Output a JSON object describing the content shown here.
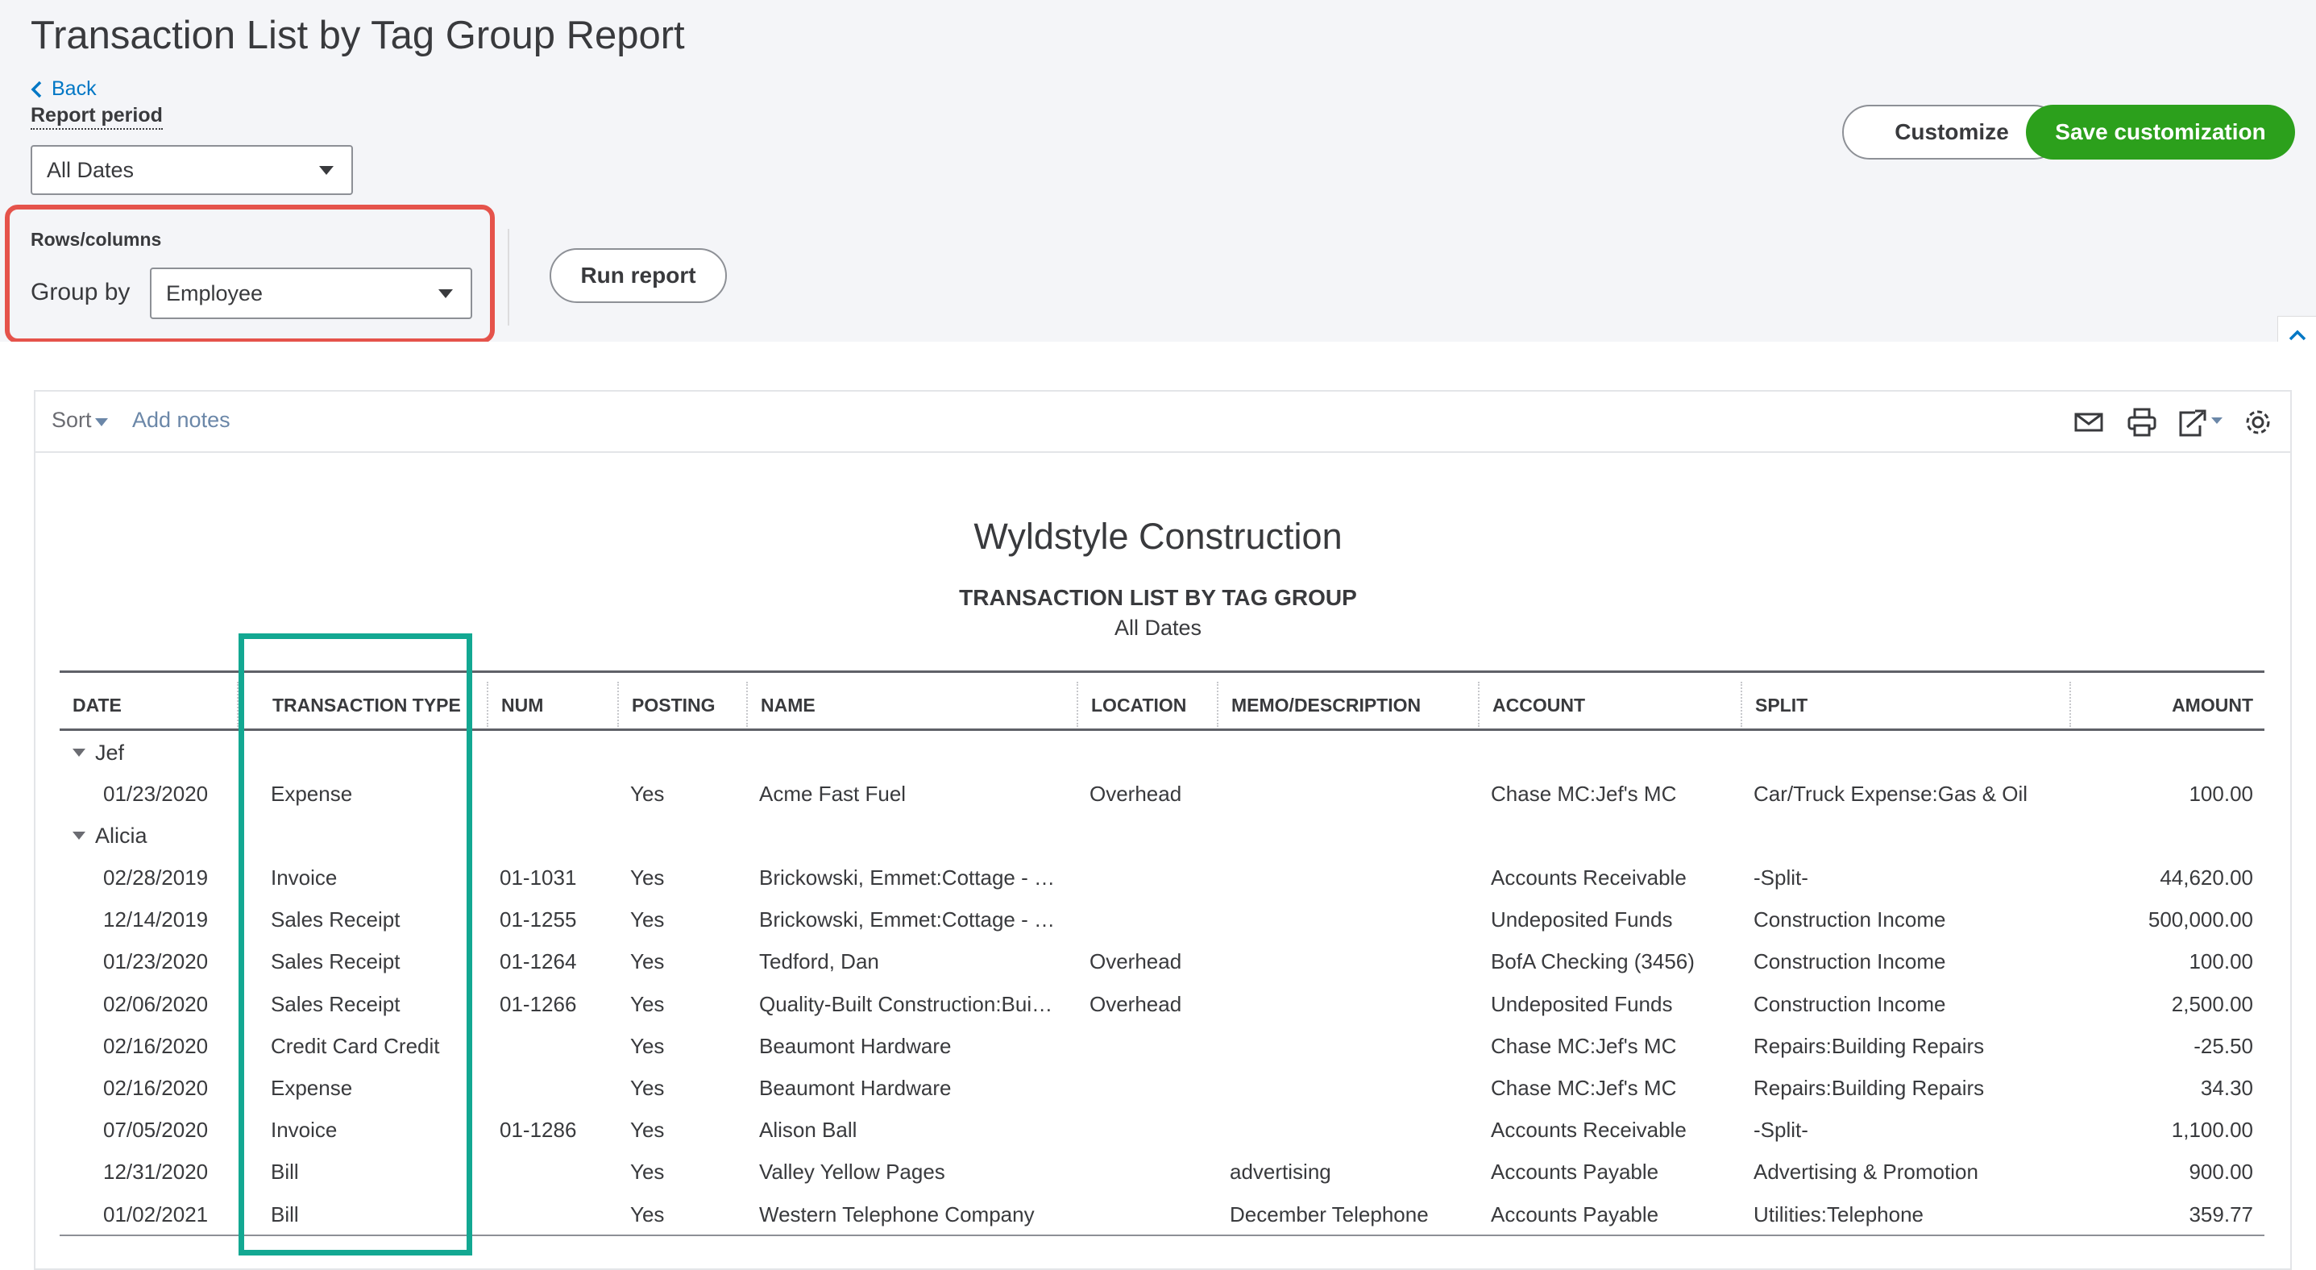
{
  "page": {
    "title": "Transaction List by Tag Group Report",
    "back_label": "Back",
    "report_period_label": "Report period",
    "report_period_value": "All Dates",
    "rows_columns_label": "Rows/columns",
    "group_by_label": "Group by",
    "group_by_value": "Employee",
    "run_report_label": "Run report",
    "customize_label": "Customize",
    "save_customization_label": "Save customization"
  },
  "toolbar": {
    "sort_label": "Sort",
    "add_notes_label": "Add notes",
    "icons": [
      "email-icon",
      "print-icon",
      "export-icon",
      "settings-icon"
    ]
  },
  "report": {
    "company": "Wyldstyle Construction",
    "name": "TRANSACTION LIST BY TAG GROUP",
    "dates": "All Dates",
    "columns": [
      "DATE",
      "TRANSACTION TYPE",
      "NUM",
      "POSTING",
      "NAME",
      "LOCATION",
      "MEMO/DESCRIPTION",
      "ACCOUNT",
      "SPLIT",
      "AMOUNT"
    ],
    "groups": [
      {
        "name": "Jef",
        "rows": [
          [
            "01/23/2020",
            "Expense",
            "",
            "Yes",
            "Acme Fast Fuel",
            "Overhead",
            "",
            "Chase MC:Jef's MC",
            "Car/Truck Expense:Gas & Oil",
            "100.00"
          ]
        ]
      },
      {
        "name": "Alicia",
        "rows": [
          [
            "02/28/2019",
            "Invoice",
            "01-1031",
            "Yes",
            "Brickowski, Emmet:Cottage - …",
            "",
            "",
            "Accounts Receivable",
            "-Split-",
            "44,620.00"
          ],
          [
            "12/14/2019",
            "Sales Receipt",
            "01-1255",
            "Yes",
            "Brickowski, Emmet:Cottage - …",
            "",
            "",
            "Undeposited Funds",
            "Construction Income",
            "500,000.00"
          ],
          [
            "01/23/2020",
            "Sales Receipt",
            "01-1264",
            "Yes",
            "Tedford, Dan",
            "Overhead",
            "",
            "BofA Checking (3456)",
            "Construction Income",
            "100.00"
          ],
          [
            "02/06/2020",
            "Sales Receipt",
            "01-1266",
            "Yes",
            "Quality-Built Construction:Bui…",
            "Overhead",
            "",
            "Undeposited Funds",
            "Construction Income",
            "2,500.00"
          ],
          [
            "02/16/2020",
            "Credit Card Credit",
            "",
            "Yes",
            "Beaumont Hardware",
            "",
            "",
            "Chase MC:Jef's MC",
            "Repairs:Building Repairs",
            "-25.50"
          ],
          [
            "02/16/2020",
            "Expense",
            "",
            "Yes",
            "Beaumont Hardware",
            "",
            "",
            "Chase MC:Jef's MC",
            "Repairs:Building Repairs",
            "34.30"
          ],
          [
            "07/05/2020",
            "Invoice",
            "01-1286",
            "Yes",
            "Alison Ball",
            "",
            "",
            "Accounts Receivable",
            "-Split-",
            "1,100.00"
          ],
          [
            "12/31/2020",
            "Bill",
            "",
            "Yes",
            "Valley Yellow Pages",
            "",
            "advertising",
            "Accounts Payable",
            "Advertising & Promotion",
            "900.00"
          ],
          [
            "01/02/2021",
            "Bill",
            "",
            "Yes",
            "Western Telephone Company",
            "",
            "December Telephone",
            "Accounts Payable",
            "Utilities:Telephone",
            "359.77"
          ]
        ]
      }
    ]
  },
  "colors": {
    "primary_green": "#2ca01c",
    "link_blue": "#0077c5",
    "highlight_red": "#e5534b",
    "highlight_teal": "#13a892"
  }
}
